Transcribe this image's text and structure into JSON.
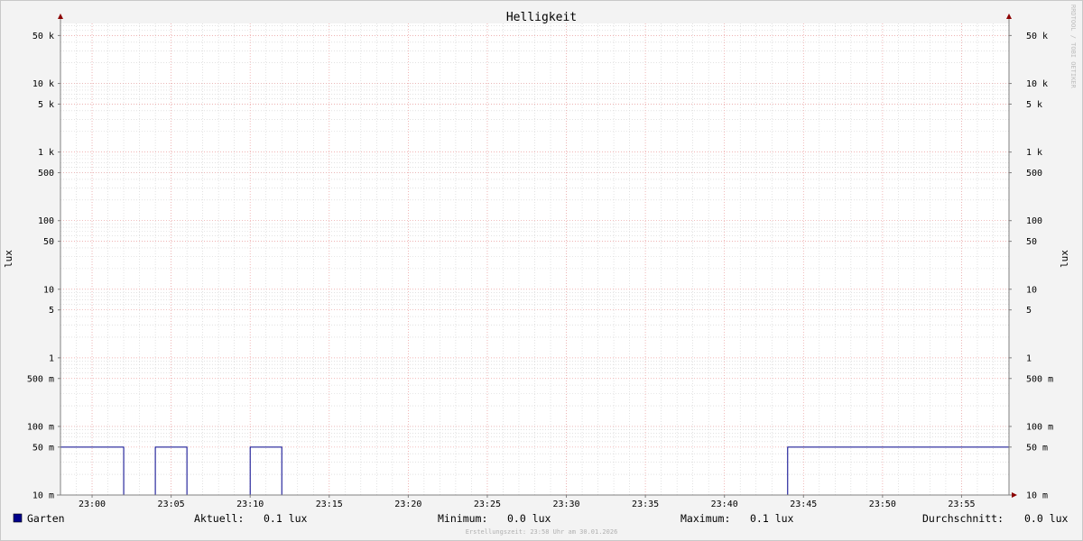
{
  "chart_data": {
    "type": "line",
    "title": "Helligkeit",
    "ylabel_left": "lux",
    "ylabel_right": "lux",
    "watermark": "RRDTOOL / TOBI OETIKER",
    "y_scale": "log",
    "ylim": [
      0.01,
      75000
    ],
    "xlim": [
      "22:58",
      "23:58"
    ],
    "x_ticks": [
      "23:00",
      "23:05",
      "23:10",
      "23:15",
      "23:20",
      "23:25",
      "23:30",
      "23:35",
      "23:40",
      "23:45",
      "23:50",
      "23:55"
    ],
    "y_ticks": [
      {
        "value": 50000,
        "label": "50 k"
      },
      {
        "value": 10000,
        "label": "10 k"
      },
      {
        "value": 5000,
        "label": "5 k"
      },
      {
        "value": 1000,
        "label": "1 k"
      },
      {
        "value": 500,
        "label": "500"
      },
      {
        "value": 100,
        "label": "100"
      },
      {
        "value": 50,
        "label": "50"
      },
      {
        "value": 10,
        "label": "10"
      },
      {
        "value": 5,
        "label": "5"
      },
      {
        "value": 1,
        "label": "1"
      },
      {
        "value": 0.5,
        "label": "500 m"
      },
      {
        "value": 0.1,
        "label": "100 m"
      },
      {
        "value": 0.05,
        "label": "50 m"
      },
      {
        "value": 0.01,
        "label": "10 m"
      }
    ],
    "grid": true,
    "series": [
      {
        "name": "Garten",
        "color": "#00008b",
        "x": [
          "22:58",
          "23:02",
          "23:02",
          "23:04",
          "23:04",
          "23:06",
          "23:06",
          "23:10",
          "23:10",
          "23:12",
          "23:12",
          "23:44",
          "23:44",
          "23:58"
        ],
        "y": [
          0.05,
          0.05,
          0.01,
          0.01,
          0.05,
          0.05,
          0.01,
          0.01,
          0.05,
          0.05,
          0.01,
          0.01,
          0.05,
          0.05
        ]
      }
    ],
    "legend": {
      "swatch_color": "#00008b",
      "name": "Garten",
      "stats": [
        {
          "label": "Aktuell:",
          "value": "0.1 lux"
        },
        {
          "label": "Minimum:",
          "value": "0.0 lux"
        },
        {
          "label": "Maximum:",
          "value": "0.1 lux"
        },
        {
          "label": "Durchschnitt:",
          "value": "0.0 lux"
        }
      ]
    },
    "footer": "Erstellungszeit: 23:58 Uhr am 30.01.2026"
  },
  "colors": {
    "background": "#f3f3f3",
    "plot_background": "#ffffff",
    "major_grid": "#f0a0a0",
    "minor_grid": "#d0d0d0",
    "axis": "#808080",
    "arrow": "#8b0000",
    "series": "#00008b"
  }
}
